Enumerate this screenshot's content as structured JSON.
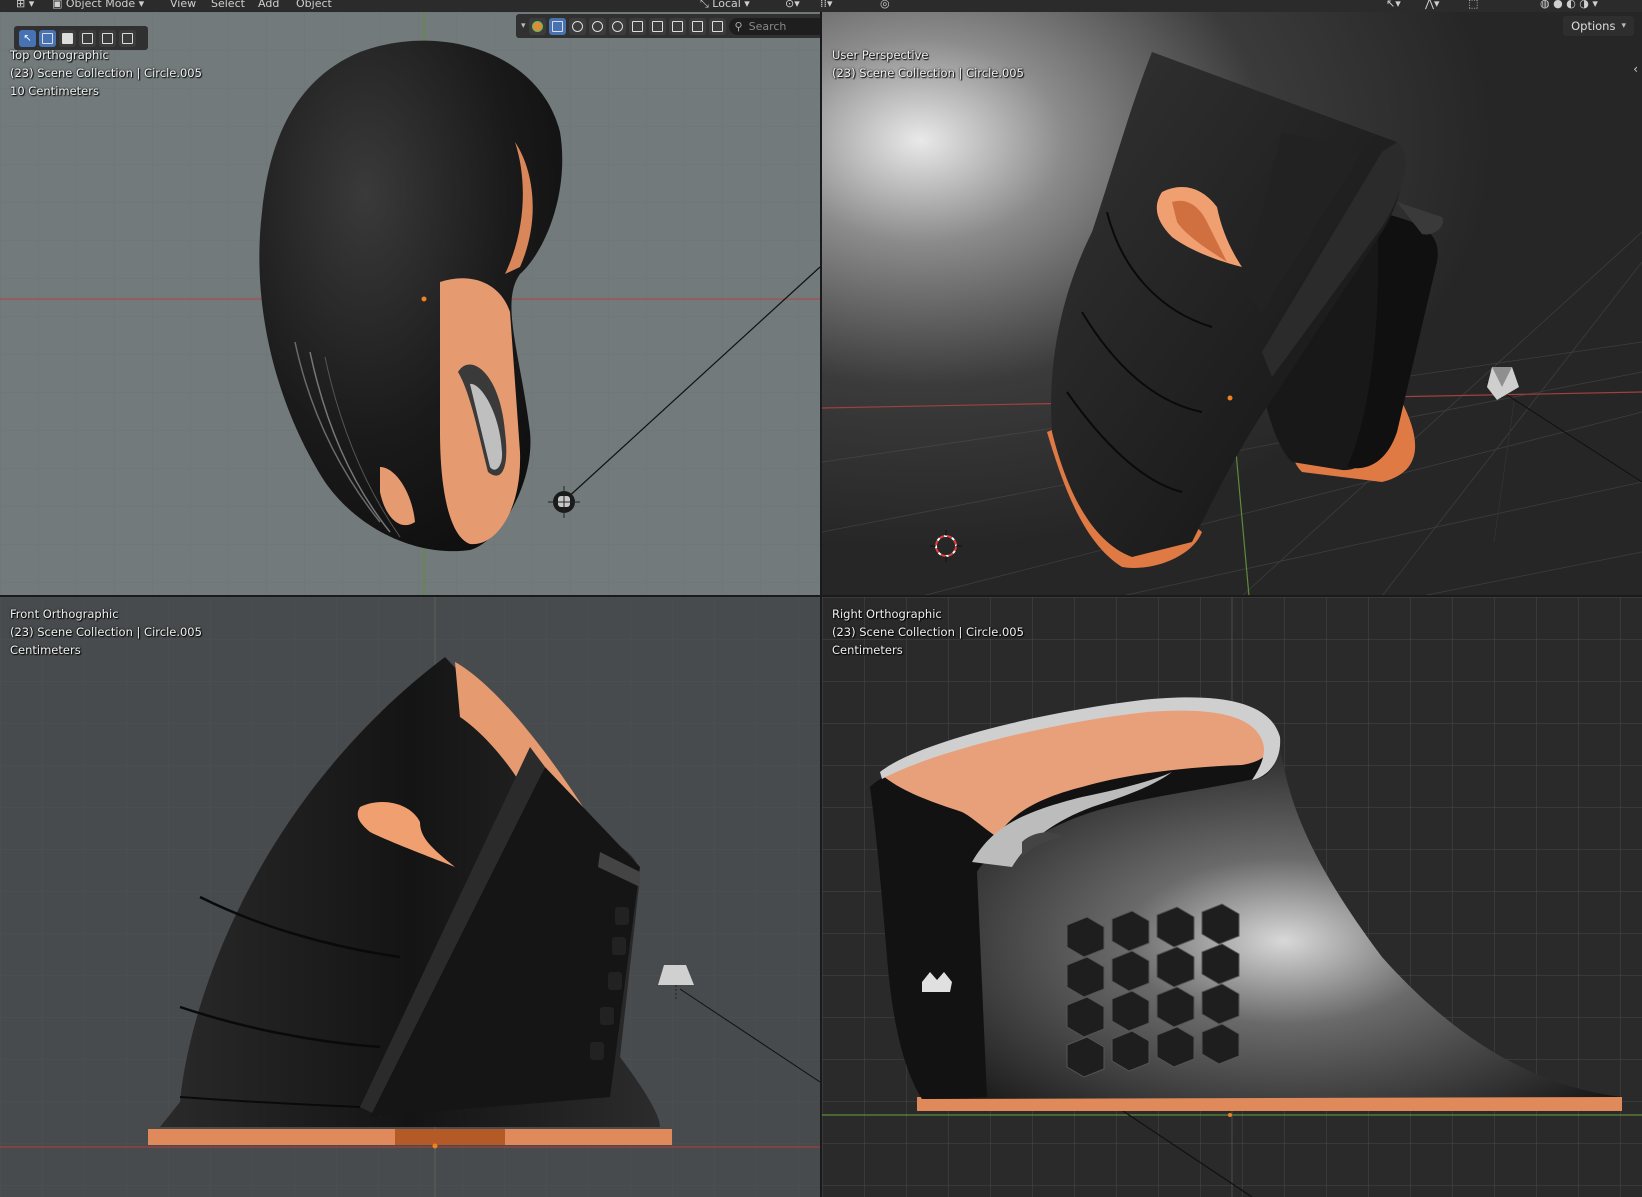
{
  "menubar": {
    "mode": "Object Mode",
    "menus": [
      "View",
      "Select",
      "Add",
      "Object"
    ],
    "transform_orientation": "Local"
  },
  "header": {
    "search_placeholder": "Search",
    "options_label": "Options"
  },
  "viewports": {
    "top_left": {
      "view": "Top Orthographic",
      "collection": "(23) Scene Collection | Circle.005",
      "units": "10 Centimeters"
    },
    "top_right": {
      "view": "User Perspective",
      "collection": "(23) Scene Collection | Circle.005"
    },
    "bottom_left": {
      "view": "Front Orthographic",
      "collection": "(23) Scene Collection | Circle.005",
      "units": "Centimeters"
    },
    "bottom_right": {
      "view": "Right Orthographic",
      "collection": "(23) Scene Collection | Circle.005",
      "units": "Centimeters"
    }
  },
  "colors": {
    "accent": "#4772b3",
    "model_dark": "#1a1a1a",
    "model_copper": "#e08a5c",
    "grid_red": "#a03a3a",
    "grid_green": "#5a8a2a"
  }
}
